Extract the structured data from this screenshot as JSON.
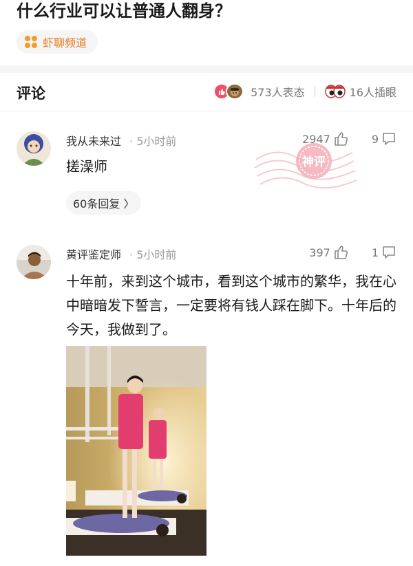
{
  "post": {
    "title": "什么行业可以让普通人翻身？",
    "channel": "虾聊频道"
  },
  "comments_header": {
    "title": "评论",
    "reactions_text": "573人表态",
    "peek_text": "16人插眼"
  },
  "comments": [
    {
      "author": "我从未来过",
      "time": "· 5小时前",
      "likes": "2947",
      "replies": "9",
      "text": "搓澡师",
      "reply_link": "60条回复 〉",
      "badge": "神评"
    },
    {
      "author": "黄评鉴定师",
      "time": "· 5小时前",
      "likes": "397",
      "replies": "1",
      "text": "十年前，来到这个城市，看到这个城市的繁华，我在心中暗暗发下誓言，一定要将有钱人踩在脚下。十年后的今天，我做到了。"
    }
  ],
  "colors": {
    "accent": "#e57a20",
    "badge": "#f0506e"
  },
  "icons": [
    "channel-icon",
    "like-reaction-icon",
    "face-reaction-icon",
    "eyes-icon",
    "thumbs-up-icon",
    "comment-icon"
  ]
}
